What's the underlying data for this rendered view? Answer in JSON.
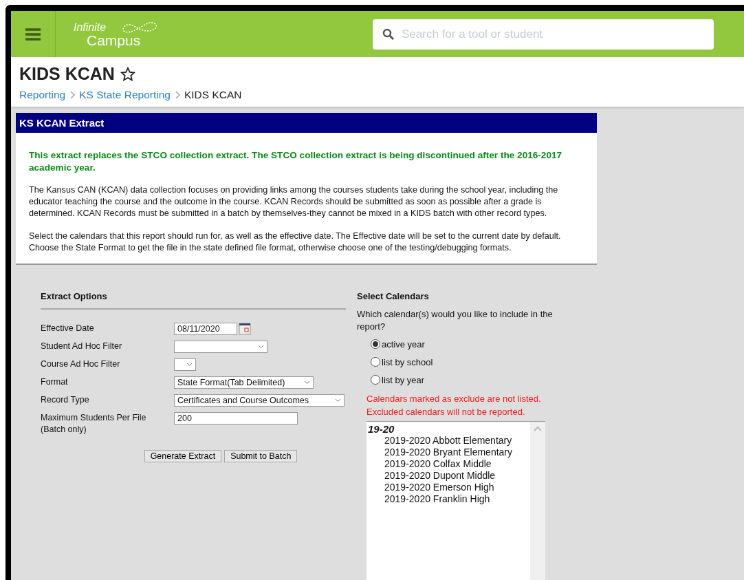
{
  "header": {
    "logo": {
      "line_1": "Infinite",
      "line_2": "Campus"
    },
    "search": {
      "placeholder": "Search for a tool or student"
    }
  },
  "page": {
    "title": "KIDS KCAN",
    "favorite": false,
    "breadcrumbs": [
      {
        "label": "Reporting",
        "kind": "link"
      },
      {
        "label": "KS State Reporting",
        "kind": "link"
      },
      {
        "label": "KIDS KCAN",
        "kind": "current"
      }
    ]
  },
  "panel": {
    "title": "KS KCAN Extract",
    "notice": "This extract replaces the STCO collection extract. The STCO collection extract is being discontinued after the 2016-2017 academic year.",
    "paragraphs": [
      "The Kansus CAN (KCAN) data collection focuses on providing links among the courses students take during the school year, including the educator teaching the course and the outcome in the course. KCAN Records should be submitted as soon as possible after a grade is determined. KCAN Records must be submitted in a batch by themselves-they cannot be mixed in a KIDS batch with other record types.",
      "Select the calendars that this report should run for, as well as the effective date. The Effective date will be set to the current date by default. Choose the State Format to get the file in the state defined file format, otherwise choose one of the testing/debugging formats."
    ]
  },
  "extract_options": {
    "heading": "Extract Options",
    "fields": [
      {
        "label": "Effective Date",
        "kind": "date",
        "value": "08/11/2020"
      },
      {
        "label": "Student Ad Hoc Filter",
        "kind": "select"
      },
      {
        "label": "Course Ad Hoc Filter",
        "kind": "select"
      },
      {
        "label": "Format",
        "kind": "select",
        "value": "State Format(Tab Delimited)"
      },
      {
        "label": "Record Type",
        "kind": "select",
        "value": "Certificates and Course Outcomes"
      },
      {
        "label": "Maximum Students Per File (Batch only)",
        "kind": "text",
        "value": "200"
      }
    ],
    "buttons": [
      "Generate Extract",
      "Submit to Batch"
    ]
  },
  "select_calendars": {
    "heading": "Select Calendars",
    "question": "Which calendar(s) would you like to include in the report?",
    "radios": [
      {
        "label": "active year",
        "selected": true
      },
      {
        "label": "list by school",
        "selected": false
      },
      {
        "label": "list by year",
        "selected": false
      }
    ],
    "warnings": [
      "Calendars marked as exclude are not listed.",
      "Excluded calendars will not be reported."
    ],
    "listbox": {
      "groups": [
        {
          "label": "19-20",
          "items": [
            "2019-2020 Abbott Elementary",
            "2019-2020 Bryant Elementary",
            "2019-2020 Colfax Middle",
            "2019-2020 Dupont Middle",
            "2019-2020 Emerson High",
            "2019-2020 Franklin High"
          ]
        }
      ]
    }
  }
}
